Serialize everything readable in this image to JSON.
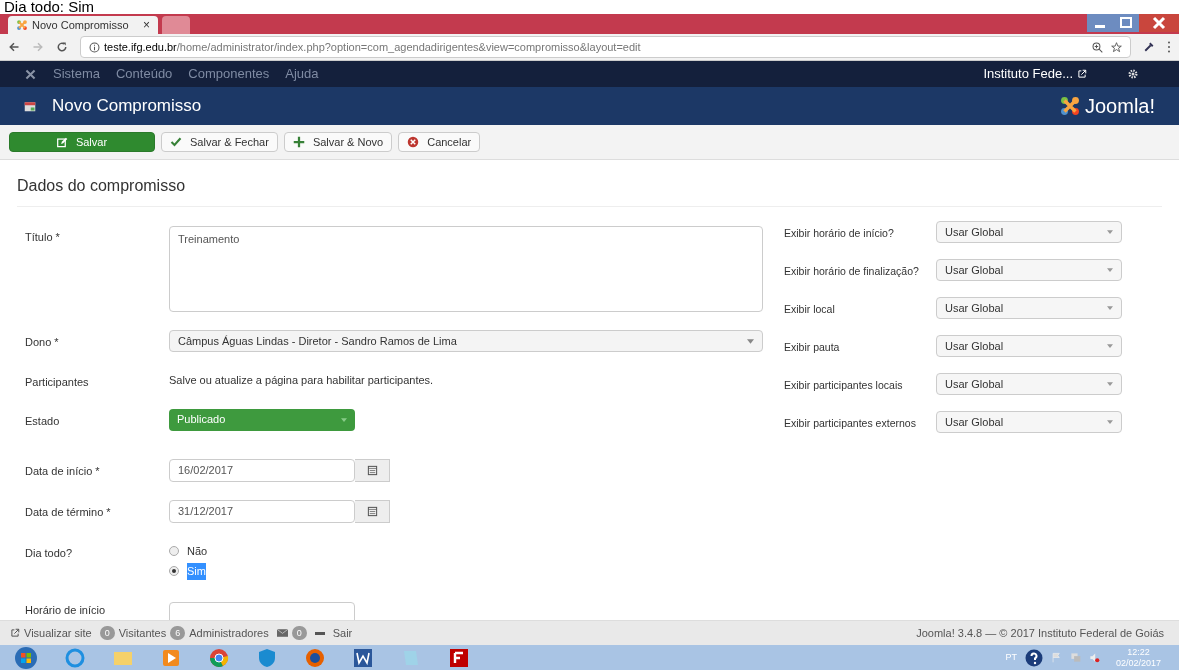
{
  "caption": "Dia todo: Sim",
  "browser": {
    "tabs": [
      {
        "title": "Novo Compromisso",
        "close": "×",
        "selected": true
      },
      {
        "selected": false
      }
    ],
    "url_host": "teste.ifg.edu.br",
    "url_path": "/home/administrator/index.php?option=com_agendadirigentes&view=compromisso&layout=edit"
  },
  "admin_menu": {
    "items": [
      "Sistema",
      "Conteúdo",
      "Componentes",
      "Ajuda"
    ],
    "site_link": "Instituto Fede..."
  },
  "header": {
    "title": "Novo Compromisso",
    "logo": "Joomla!"
  },
  "toolbar": [
    {
      "label": "Salvar",
      "kind": "primary"
    },
    {
      "label": "Salvar & Fechar",
      "kind": "check"
    },
    {
      "label": "Salvar & Novo",
      "kind": "plus"
    },
    {
      "label": "Cancelar",
      "kind": "cancel"
    }
  ],
  "section_title": "Dados do compromisso",
  "fields": [
    {
      "label": "Título *",
      "kind": "textarea",
      "value": "Treinamento"
    },
    {
      "label": "Dono *",
      "kind": "select",
      "value": "Câmpus Águas Lindas - Diretor - Sandro Ramos de Lima"
    },
    {
      "label": "Participantes",
      "kind": "note",
      "value": "Salve ou atualize a página para habilitar participantes."
    },
    {
      "label": "Estado",
      "kind": "status",
      "value": "Publicado"
    },
    {
      "label": "Data de início *",
      "kind": "date",
      "value": "16/02/2017"
    },
    {
      "label": "Data de término *",
      "kind": "date",
      "value": "31/12/2017"
    },
    {
      "label": "Dia todo?",
      "kind": "radio",
      "options": [
        {
          "label": "Não",
          "selected": false
        },
        {
          "label": "Sim",
          "selected": true
        }
      ]
    },
    {
      "label": "Horário de início",
      "kind": "text"
    }
  ],
  "options": [
    {
      "label": "Exibir horário de início?",
      "value": "Usar Global"
    },
    {
      "label": "Exibir horário de finalização?",
      "value": "Usar Global"
    },
    {
      "label": "Exibir local",
      "value": "Usar Global"
    },
    {
      "label": "Exibir pauta",
      "value": "Usar Global"
    },
    {
      "label": "Exibir participantes locais",
      "value": "Usar Global"
    },
    {
      "label": "Exibir participantes externos",
      "value": "Usar Global"
    }
  ],
  "status_bar": {
    "view_site": "Visualizar site",
    "visitors_count": "0",
    "visitors": "Visitantes",
    "admins_count": "6",
    "admins": "Administradores",
    "messages_count": "0",
    "logout": "Sair",
    "footer": "Joomla! 3.4.8 — © 2017 Instituto Federal de Goiás"
  },
  "taskbar": {
    "language": "PT",
    "time": "12:22",
    "date": "02/02/2017"
  }
}
